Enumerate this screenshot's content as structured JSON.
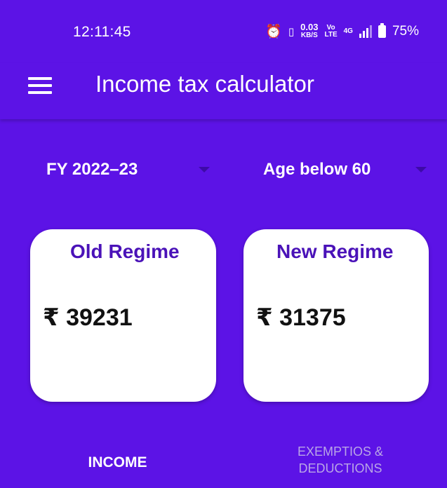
{
  "status_bar": {
    "time": "12:11:45",
    "speed_value": "0.03",
    "speed_unit": "KB/S",
    "volte_top": "Vo",
    "volte_bottom": "LTE",
    "network": "4G",
    "battery": "75%"
  },
  "app_bar": {
    "title": "Income tax calculator"
  },
  "filters": {
    "financial_year": "FY 2022–23",
    "age_group": "Age below 60"
  },
  "cards": {
    "old_regime": {
      "title": "Old Regime",
      "amount": "₹ 39231"
    },
    "new_regime": {
      "title": "New Regime",
      "amount": "₹ 31375"
    }
  },
  "tabs": {
    "income": "INCOME",
    "exemptions_line1": "EXEMPTIOS &",
    "exemptions_line2": "DEDUCTIONS"
  },
  "colors": {
    "background": "#5c13e6",
    "card_title": "#4a12b8",
    "inactive_tab": "#b9a5e6"
  }
}
